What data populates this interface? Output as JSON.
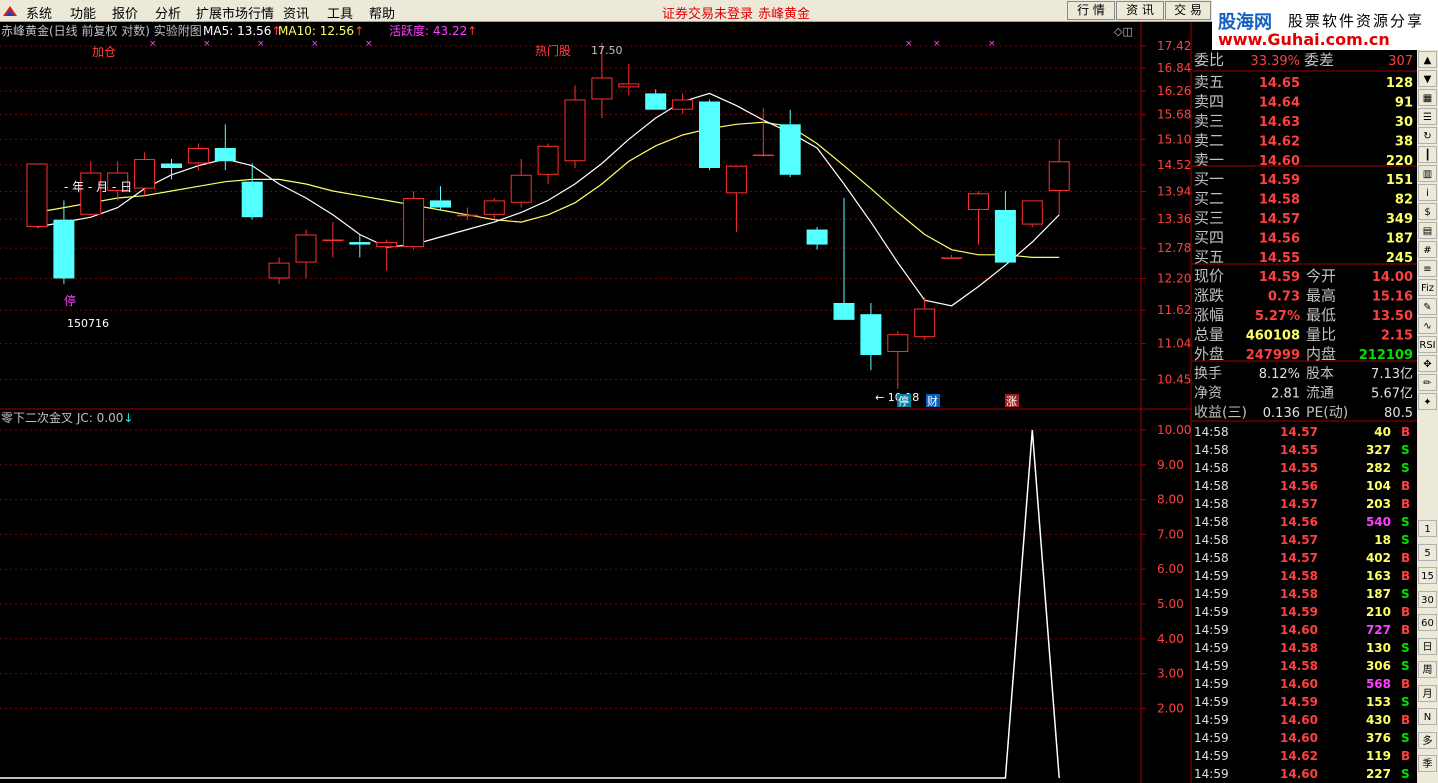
{
  "menu": {
    "items": [
      "系统",
      "功能",
      "报价",
      "分析",
      "扩展市场行情",
      "资讯",
      "工具",
      "帮助"
    ],
    "notice": "证券交易未登录",
    "notice_stock": "赤峰黄金",
    "buttons": [
      "行 情",
      "资 讯",
      "交 易"
    ]
  },
  "banner": {
    "brand": "股海网",
    "slogan": "股票软件资源分享",
    "url": "www.Guhai.com.cn"
  },
  "chart_data": [
    {
      "type": "candlestick",
      "title": "赤峰黄金(日线 前复权 对数) 实验附图",
      "indicators": [
        {
          "name": "MA5",
          "value": "13.56",
          "arrow": "↑",
          "color": "#ffffff"
        },
        {
          "name": "MA10",
          "value": "12.56",
          "arrow": "↑",
          "color": "#ffff66"
        }
      ],
      "activity": "活跃度: 43.22",
      "activity_arrow": "↑",
      "scale": "log",
      "ylim": [
        10.0,
        17.9
      ],
      "yticks": [
        "17.42",
        "16.84",
        "16.26",
        "15.68",
        "15.10",
        "14.52",
        "13.94",
        "13.36",
        "12.78",
        "12.20",
        "11.62",
        "11.04",
        "10.45"
      ],
      "candles": [
        {
          "o": 13.2,
          "h": 14.55,
          "l": 13.2,
          "c": 14.55
        },
        {
          "o": 13.35,
          "h": 13.75,
          "l": 12.1,
          "c": 12.2
        },
        {
          "o": 13.45,
          "h": 14.6,
          "l": 13.45,
          "c": 14.35
        },
        {
          "o": 13.95,
          "h": 14.6,
          "l": 13.75,
          "c": 14.35
        },
        {
          "o": 14.0,
          "h": 14.8,
          "l": 13.85,
          "c": 14.65
        },
        {
          "o": 14.55,
          "h": 14.65,
          "l": 14.2,
          "c": 14.45
        },
        {
          "o": 14.55,
          "h": 15.0,
          "l": 14.4,
          "c": 14.9
        },
        {
          "o": 14.9,
          "h": 15.45,
          "l": 14.4,
          "c": 14.6
        },
        {
          "o": 14.15,
          "h": 14.55,
          "l": 13.35,
          "c": 13.4
        },
        {
          "o": 12.2,
          "h": 12.6,
          "l": 12.1,
          "c": 12.5
        },
        {
          "o": 12.5,
          "h": 13.15,
          "l": 12.2,
          "c": 13.05
        },
        {
          "o": 12.95,
          "h": 13.3,
          "l": 12.6,
          "c": 12.95
        },
        {
          "o": 12.9,
          "h": 13.05,
          "l": 12.6,
          "c": 12.85
        },
        {
          "o": 12.8,
          "h": 12.95,
          "l": 12.35,
          "c": 12.9
        },
        {
          "o": 12.8,
          "h": 13.95,
          "l": 12.75,
          "c": 13.8
        },
        {
          "o": 13.75,
          "h": 14.05,
          "l": 13.55,
          "c": 13.6
        },
        {
          "o": 13.45,
          "h": 13.6,
          "l": 13.35,
          "c": 13.45
        },
        {
          "o": 13.45,
          "h": 13.8,
          "l": 13.35,
          "c": 13.75
        },
        {
          "o": 13.7,
          "h": 14.65,
          "l": 13.6,
          "c": 14.3
        },
        {
          "o": 14.3,
          "h": 15.0,
          "l": 14.1,
          "c": 14.95
        },
        {
          "o": 14.6,
          "h": 16.4,
          "l": 14.45,
          "c": 16.05
        },
        {
          "o": 16.05,
          "h": 17.5,
          "l": 15.6,
          "c": 16.6
        },
        {
          "o": 16.35,
          "h": 16.95,
          "l": 16.15,
          "c": 16.45
        },
        {
          "o": 16.2,
          "h": 16.3,
          "l": 15.8,
          "c": 15.8
        },
        {
          "o": 15.8,
          "h": 16.2,
          "l": 15.7,
          "c": 16.05
        },
        {
          "o": 16.0,
          "h": 16.05,
          "l": 14.4,
          "c": 14.45
        },
        {
          "o": 13.9,
          "h": 14.5,
          "l": 13.1,
          "c": 14.5
        },
        {
          "o": 14.75,
          "h": 15.85,
          "l": 14.7,
          "c": 14.75
        },
        {
          "o": 15.45,
          "h": 15.8,
          "l": 14.25,
          "c": 14.3
        },
        {
          "o": 13.15,
          "h": 13.2,
          "l": 12.75,
          "c": 12.85
        },
        {
          "o": 11.75,
          "h": 13.8,
          "l": 11.5,
          "c": 11.45
        },
        {
          "o": 11.55,
          "h": 11.75,
          "l": 10.6,
          "c": 10.85
        },
        {
          "o": 10.9,
          "h": 11.25,
          "l": 10.3,
          "c": 11.2
        },
        {
          "o": 11.15,
          "h": 11.85,
          "l": 11.1,
          "c": 11.65
        },
        {
          "o": 12.6,
          "h": 12.65,
          "l": 12.6,
          "c": 12.6
        },
        {
          "o": 13.55,
          "h": 13.95,
          "l": 12.85,
          "c": 13.9
        },
        {
          "o": 13.55,
          "h": 13.95,
          "l": 12.5,
          "c": 12.5
        },
        {
          "o": 13.25,
          "h": 13.75,
          "l": 13.2,
          "c": 13.75
        },
        {
          "o": 13.95,
          "h": 15.1,
          "l": 13.45,
          "c": 14.6
        }
      ],
      "ma5": [
        13.2,
        13.3,
        13.4,
        13.6,
        14.0,
        14.3,
        14.5,
        14.65,
        14.5,
        14.1,
        13.8,
        13.45,
        13.05,
        12.8,
        12.85,
        13.0,
        13.15,
        13.3,
        13.5,
        13.75,
        14.1,
        14.55,
        15.1,
        15.6,
        16.0,
        16.2,
        15.9,
        15.55,
        15.25,
        14.9,
        14.1,
        13.3,
        12.5,
        11.8,
        11.7,
        12.05,
        12.45,
        12.9,
        13.45
      ],
      "ma10": [
        13.5,
        13.6,
        13.7,
        13.8,
        13.85,
        13.95,
        14.05,
        14.15,
        14.2,
        14.2,
        14.1,
        13.95,
        13.85,
        13.75,
        13.65,
        13.55,
        13.45,
        13.35,
        13.3,
        13.45,
        13.7,
        14.1,
        14.6,
        14.95,
        15.2,
        15.35,
        15.45,
        15.5,
        15.4,
        15.0,
        14.5,
        14.0,
        13.5,
        13.05,
        12.75,
        12.65,
        12.65,
        12.6,
        12.6
      ],
      "annotations": [
        {
          "text": "加仓"
        },
        {
          "text": "热门股"
        },
        {
          "text": "17.50"
        },
        {
          "text": "- 年 - 月 - 日"
        },
        {
          "text": "停"
        },
        {
          "text": "150716"
        },
        {
          "text": "← 10.18"
        },
        {
          "text": "停"
        },
        {
          "text": "财"
        },
        {
          "text": "涨"
        }
      ]
    },
    {
      "type": "line",
      "title": "零下二次金叉",
      "indicator": "JC: 0.00",
      "indicator_arrow": "↓",
      "ylim": [
        0,
        10.6
      ],
      "yticks": [
        "10.00",
        "9.00",
        "8.00",
        "7.00",
        "6.00",
        "5.00",
        "4.00",
        "3.00",
        "2.00"
      ],
      "values": [
        0,
        0,
        0,
        0,
        0,
        0,
        0,
        0,
        0,
        0,
        0,
        0,
        0,
        0,
        0,
        0,
        0,
        0,
        0,
        0,
        0,
        0,
        0,
        0,
        0,
        0,
        0,
        0,
        0,
        0,
        0,
        0,
        0,
        0,
        0,
        0,
        0,
        10,
        0
      ]
    }
  ],
  "quote": {
    "weibi_label": "委比",
    "weibi_value": "33.39%",
    "weicha_label": "委差",
    "weicha_value": "307",
    "asks": [
      {
        "label": "卖五",
        "price": "14.65",
        "vol": "128"
      },
      {
        "label": "卖四",
        "price": "14.64",
        "vol": "91"
      },
      {
        "label": "卖三",
        "price": "14.63",
        "vol": "30"
      },
      {
        "label": "卖二",
        "price": "14.62",
        "vol": "38"
      },
      {
        "label": "卖一",
        "price": "14.60",
        "vol": "220"
      }
    ],
    "bids": [
      {
        "label": "买一",
        "price": "14.59",
        "vol": "151"
      },
      {
        "label": "买二",
        "price": "14.58",
        "vol": "82"
      },
      {
        "label": "买三",
        "price": "14.57",
        "vol": "349"
      },
      {
        "label": "买四",
        "price": "14.56",
        "vol": "187"
      },
      {
        "label": "买五",
        "price": "14.55",
        "vol": "245"
      }
    ],
    "stats": [
      {
        "l1": "现价",
        "v1": "14.59",
        "c1": "#ff4040",
        "l2": "今开",
        "v2": "14.00",
        "c2": "#ff4040"
      },
      {
        "l1": "涨跌",
        "v1": "0.73",
        "c1": "#ff4040",
        "l2": "最高",
        "v2": "15.16",
        "c2": "#ff4040"
      },
      {
        "l1": "涨幅",
        "v1": "5.27%",
        "c1": "#ff4040",
        "l2": "最低",
        "v2": "13.50",
        "c2": "#ff4040"
      },
      {
        "l1": "总量",
        "v1": "460108",
        "c1": "#ffff66",
        "l2": "量比",
        "v2": "2.15",
        "c2": "#ff4040"
      },
      {
        "l1": "外盘",
        "v1": "247999",
        "c1": "#ff4040",
        "l2": "内盘",
        "v2": "212109",
        "c2": "#00e000"
      }
    ],
    "stats2": [
      {
        "l1": "换手",
        "v1": "8.12%",
        "l2": "股本",
        "v2": "7.13亿"
      },
      {
        "l1": "净资",
        "v1": "2.81",
        "l2": "流通",
        "v2": "5.67亿"
      },
      {
        "l1": "收益(三)",
        "v1": "0.136",
        "l2": "PE(动)",
        "v2": "80.5"
      }
    ],
    "ticks": [
      {
        "t": "14:58",
        "p": "14.57",
        "v": "40",
        "s": "B"
      },
      {
        "t": "14:58",
        "p": "14.55",
        "v": "327",
        "s": "S"
      },
      {
        "t": "14:58",
        "p": "14.55",
        "v": "282",
        "s": "S"
      },
      {
        "t": "14:58",
        "p": "14.56",
        "v": "104",
        "s": "B"
      },
      {
        "t": "14:58",
        "p": "14.57",
        "v": "203",
        "s": "B"
      },
      {
        "t": "14:58",
        "p": "14.56",
        "v": "540",
        "s": "S",
        "big": true
      },
      {
        "t": "14:58",
        "p": "14.57",
        "v": "18",
        "s": "S"
      },
      {
        "t": "14:58",
        "p": "14.57",
        "v": "402",
        "s": "B"
      },
      {
        "t": "14:59",
        "p": "14.58",
        "v": "163",
        "s": "B"
      },
      {
        "t": "14:59",
        "p": "14.58",
        "v": "187",
        "s": "S"
      },
      {
        "t": "14:59",
        "p": "14.59",
        "v": "210",
        "s": "B"
      },
      {
        "t": "14:59",
        "p": "14.60",
        "v": "727",
        "s": "B",
        "big": true
      },
      {
        "t": "14:59",
        "p": "14.58",
        "v": "130",
        "s": "S"
      },
      {
        "t": "14:59",
        "p": "14.58",
        "v": "306",
        "s": "S"
      },
      {
        "t": "14:59",
        "p": "14.60",
        "v": "568",
        "s": "B",
        "big": true
      },
      {
        "t": "14:59",
        "p": "14.59",
        "v": "153",
        "s": "S"
      },
      {
        "t": "14:59",
        "p": "14.60",
        "v": "430",
        "s": "B"
      },
      {
        "t": "14:59",
        "p": "14.60",
        "v": "376",
        "s": "S"
      },
      {
        "t": "14:59",
        "p": "14.62",
        "v": "119",
        "s": "B"
      },
      {
        "t": "14:59",
        "p": "14.60",
        "v": "227",
        "s": "S"
      }
    ]
  },
  "toolbar": {
    "icons": [
      "up-arrow-icon",
      "down-arrow-icon",
      "grid-icon",
      "list-icon",
      "refresh-icon",
      "candle-icon",
      "bars-icon",
      "info-icon",
      "fund-icon",
      "doc-icon",
      "hash-icon",
      "rank-icon",
      "fiz-icon",
      "pen-icon",
      "wave-icon",
      "rsi-icon",
      "move-icon",
      "pencil-icon",
      "magic-icon"
    ],
    "labels": [
      "Fiz",
      "RSI"
    ],
    "periods": [
      "1",
      "5",
      "15",
      "30",
      "60",
      "日",
      "周",
      "月",
      "N",
      "多",
      "季"
    ]
  }
}
